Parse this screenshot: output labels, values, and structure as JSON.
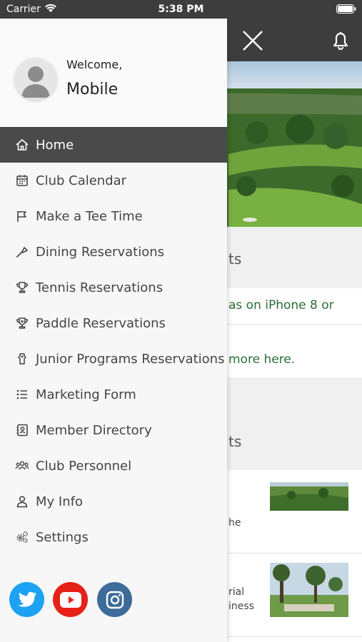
{
  "status_bar": {
    "carrier": "Carrier",
    "time": "5:38 PM"
  },
  "drawer": {
    "welcome": "Welcome,",
    "username": "Mobile",
    "menu": [
      {
        "label": "Home",
        "icon": "home-icon",
        "active": true
      },
      {
        "label": "Club Calendar",
        "icon": "calendar-icon"
      },
      {
        "label": "Make a Tee Time",
        "icon": "flag-icon"
      },
      {
        "label": "Dining Reservations",
        "icon": "dining-icon"
      },
      {
        "label": "Tennis Reservations",
        "icon": "trophy-icon"
      },
      {
        "label": "Paddle Reservations",
        "icon": "paddle-trophy-icon"
      },
      {
        "label": "Junior Programs Reservations",
        "icon": "junior-icon"
      },
      {
        "label": "Marketing Form",
        "icon": "list-icon"
      },
      {
        "label": "Member Directory",
        "icon": "directory-icon"
      },
      {
        "label": "Club Personnel",
        "icon": "people-icon"
      },
      {
        "label": "My Info",
        "icon": "user-icon"
      },
      {
        "label": "Settings",
        "icon": "gear-icon"
      }
    ],
    "social": [
      {
        "name": "twitter",
        "color": "#1da1f2"
      },
      {
        "name": "youtube",
        "color": "#e62117"
      },
      {
        "name": "instagram",
        "color": "#3d6b9a"
      }
    ]
  },
  "background": {
    "section1_heading": "ts",
    "news1": "as on iPhone 8 or",
    "news2": "more here.",
    "section2_heading": "ts",
    "event1_text": "he",
    "event2_line1": "rial",
    "event2_line2": "iness"
  },
  "colors": {
    "header": "#3d3d3d",
    "active_menu": "#4a4a4a",
    "link_green": "#2a6e36"
  }
}
